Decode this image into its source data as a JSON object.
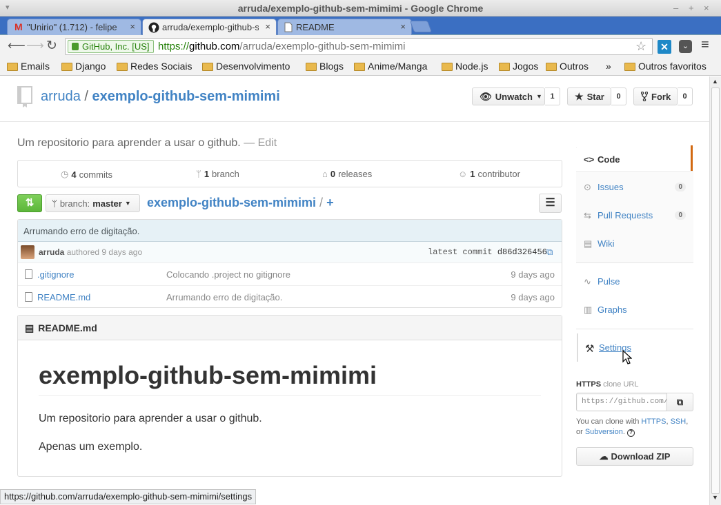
{
  "window": {
    "title": "arruda/exemplo-github-sem-mimimi - Google Chrome"
  },
  "tabs": [
    {
      "label": "\"Unirio\" (1.712) - felipe"
    },
    {
      "label": "arruda/exemplo-github-sem"
    },
    {
      "label": "README"
    }
  ],
  "omnibox": {
    "security_label": "GitHub, Inc. [US]",
    "scheme": "https://",
    "host": "github.com",
    "path": "/arruda/exemplo-github-sem-mimimi"
  },
  "bookmarks": [
    "Emails",
    "Django",
    "Redes Sociais",
    "Desenvolvimento",
    "Blogs",
    "Anime/Manga",
    "Node.js",
    "Jogos",
    "Outros"
  ],
  "bookmarks_more": "»",
  "bookmarks_other": "Outros favoritos",
  "repo": {
    "owner": "arruda",
    "separator": "/",
    "name": "exemplo-github-sem-mimimi",
    "description": "Um repositorio para aprender a usar o github.",
    "edit_label": "— Edit"
  },
  "actions": {
    "unwatch_label": "Unwatch",
    "unwatch_count": "1",
    "star_label": "Star",
    "star_count": "0",
    "fork_label": "Fork",
    "fork_count": "0"
  },
  "stats": [
    {
      "num": "4",
      "label": "commits"
    },
    {
      "num": "1",
      "label": "branch"
    },
    {
      "num": "0",
      "label": "releases"
    },
    {
      "num": "1",
      "label": "contributor"
    }
  ],
  "branch": {
    "prefix": "branch:",
    "name": "master"
  },
  "breadcrumb": {
    "repo": "exemplo-github-sem-mimimi",
    "sep": "/",
    "add": "+"
  },
  "commit": {
    "message": "Arrumando erro de digitação.",
    "author": "arruda",
    "authored_text": "authored 9 days ago",
    "latest_label": "latest commit",
    "sha": "d86d326456"
  },
  "files": [
    {
      "name": ".gitignore",
      "message": "Colocando .project no gitignore",
      "age": "9 days ago"
    },
    {
      "name": "README.md",
      "message": "Arrumando erro de digitação.",
      "age": "9 days ago"
    }
  ],
  "readme": {
    "filename": "README.md",
    "heading": "exemplo-github-sem-mimimi",
    "paragraph1": "Um repositorio para aprender a usar o github.",
    "paragraph2": "Apenas um exemplo."
  },
  "sidebar": {
    "code": "Code",
    "issues": "Issues",
    "issues_count": "0",
    "pulls": "Pull Requests",
    "pulls_count": "0",
    "wiki": "Wiki",
    "pulse": "Pulse",
    "graphs": "Graphs",
    "settings": "Settings"
  },
  "clone": {
    "title": "HTTPS",
    "subtitle": "clone URL",
    "url": "https://github.com/arruda/exemplo-github-sem-mimimi.git",
    "help_prefix": "You can clone with",
    "https_link": "HTTPS",
    "ssh_link": "SSH",
    "or": "or",
    "subversion_link": "Subversion",
    "download_label": "Download ZIP"
  },
  "statusbar": {
    "url": "https://github.com/arruda/exemplo-github-sem-mimimi/settings"
  },
  "colors": {
    "accent": "#4183c4",
    "tab_strip": "#3b6fc2",
    "active_nav": "#d26911",
    "green_button": "#6cc644"
  }
}
